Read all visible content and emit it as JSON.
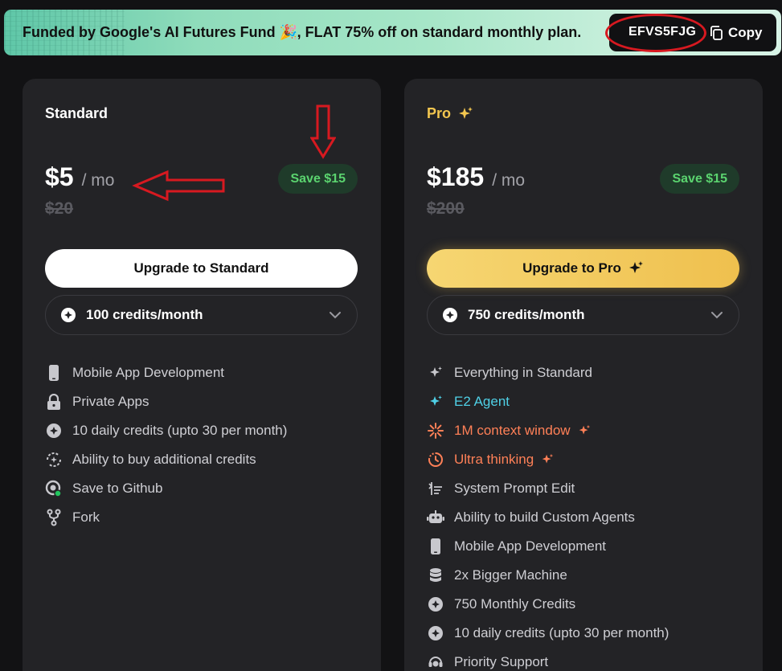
{
  "banner": {
    "text_before": "Funded by Google's AI Futures Fund",
    "emoji": "🎉",
    "text_after": ", FLAT 75% off on standard monthly plan.",
    "coupon_code": "EFVS5FJG",
    "copy_label": "Copy"
  },
  "plans": {
    "standard": {
      "name": "Standard",
      "price": "$5",
      "per": "/ mo",
      "old_price": "$20",
      "save": "Save $15",
      "button": "Upgrade to Standard",
      "credits": "100 credits/month",
      "features": [
        {
          "label": "Mobile App Development",
          "icon": "phone-icon"
        },
        {
          "label": "Private Apps",
          "icon": "lock-icon"
        },
        {
          "label": "10 daily credits (upto 30 per month)",
          "icon": "credit-icon"
        },
        {
          "label": "Ability to buy additional credits",
          "icon": "refresh-credit-icon"
        },
        {
          "label": "Save to Github",
          "icon": "github-icon"
        },
        {
          "label": "Fork",
          "icon": "fork-icon"
        }
      ]
    },
    "pro": {
      "name": "Pro",
      "price": "$185",
      "per": "/ mo",
      "old_price": "$200",
      "save": "Save $15",
      "button": "Upgrade to Pro",
      "credits": "750 credits/month",
      "features": [
        {
          "label": "Everything in Standard",
          "icon": "sparkle-icon"
        },
        {
          "label": "E2 Agent",
          "icon": "sparkle-icon"
        },
        {
          "label": "1M context window",
          "icon": "burst-icon"
        },
        {
          "label": "Ultra thinking",
          "icon": "clock-icon"
        },
        {
          "label": "System Prompt Edit",
          "icon": "prompt-edit-icon"
        },
        {
          "label": "Ability to build Custom Agents",
          "icon": "robot-icon"
        },
        {
          "label": "Mobile App Development",
          "icon": "phone-icon"
        },
        {
          "label": "2x Bigger Machine",
          "icon": "database-icon"
        },
        {
          "label": "750 Monthly Credits",
          "icon": "credit-icon"
        },
        {
          "label": "10 daily credits (upto 30 per month)",
          "icon": "credit-icon"
        },
        {
          "label": "Priority Support",
          "icon": "support-icon"
        }
      ]
    }
  },
  "colors": {
    "background": "#121214",
    "card": "#232326",
    "pro_gold": "#f3c64f",
    "save_green": "#5bd46f",
    "e2_cyan": "#4fd0e6",
    "orange": "#ff8057",
    "annotation_red": "#d71920"
  }
}
